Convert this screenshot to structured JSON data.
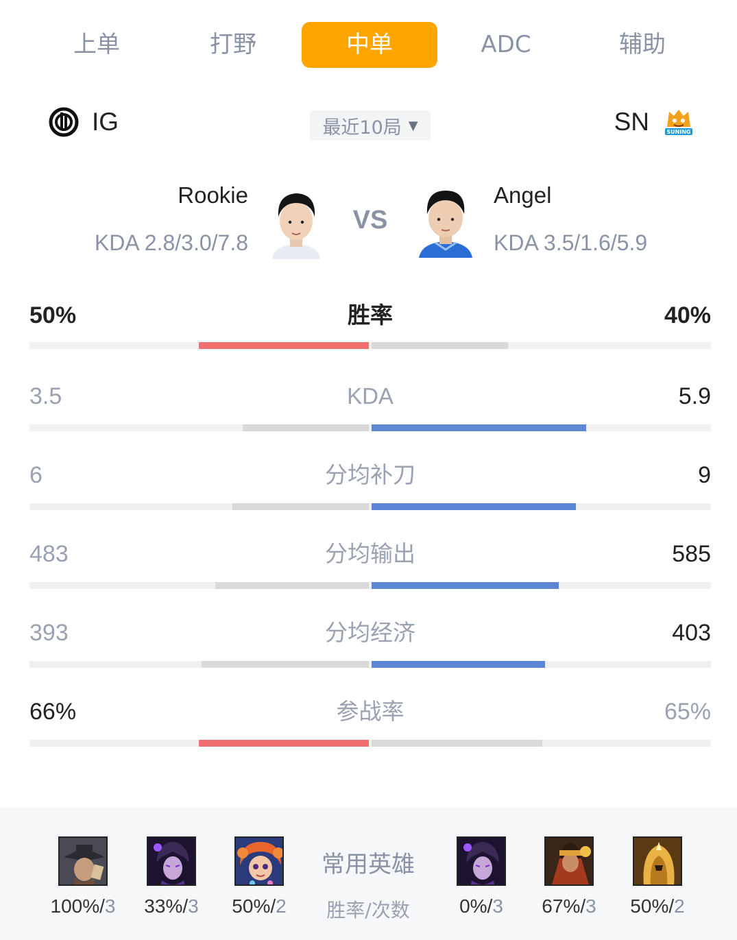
{
  "tabs": [
    {
      "label": "上单",
      "active": false
    },
    {
      "label": "打野",
      "active": false
    },
    {
      "label": "中单",
      "active": true
    },
    {
      "label": "ADC",
      "active": false
    },
    {
      "label": "辅助",
      "active": false
    }
  ],
  "teams": {
    "left": {
      "name": "IG",
      "logo_icon": "ig-logo-icon"
    },
    "right": {
      "name": "SN",
      "logo_icon": "suning-logo-icon",
      "logo_text": "SUNING"
    }
  },
  "filter": {
    "label": "最近10局",
    "icon": "caret-down-icon"
  },
  "players": {
    "left": {
      "name": "Rookie",
      "kda": "KDA 2.8/3.0/7.8"
    },
    "right": {
      "name": "Angel",
      "kda": "KDA 3.5/1.6/5.9"
    },
    "vs": "VS"
  },
  "colors": {
    "accent": "#ffa500",
    "win_red": "#f07070",
    "blue": "#5b87d6",
    "neutral_bar": "#d9d9db",
    "track": "#f0f0f0"
  },
  "stats": [
    {
      "label": "胜率",
      "left": "50%",
      "right": "40%",
      "left_fraction": 0.5,
      "right_fraction": 0.4,
      "winner": "left",
      "left_color": "win_red"
    },
    {
      "label": "KDA",
      "left": "3.5",
      "right": "5.9",
      "left_fraction": 0.37,
      "right_fraction": 0.63,
      "winner": "right",
      "right_color": "blue"
    },
    {
      "label": "分均补刀",
      "left": "6",
      "right": "9",
      "left_fraction": 0.4,
      "right_fraction": 0.6,
      "winner": "right",
      "right_color": "blue"
    },
    {
      "label": "分均输出",
      "left": "483",
      "right": "585",
      "left_fraction": 0.45,
      "right_fraction": 0.55,
      "winner": "right",
      "right_color": "blue"
    },
    {
      "label": "分均经济",
      "left": "393",
      "right": "403",
      "left_fraction": 0.49,
      "right_fraction": 0.51,
      "winner": "right",
      "right_color": "blue"
    },
    {
      "label": "参战率",
      "left": "66%",
      "right": "65%",
      "left_fraction": 0.5,
      "right_fraction": 0.5,
      "winner": "left",
      "left_color": "win_red"
    }
  ],
  "heroes": {
    "title": "常用英雄",
    "subtitle": "胜率/次数",
    "left": [
      {
        "icon": "twisted-fate-hero-icon",
        "rate": "100%",
        "count": "3"
      },
      {
        "icon": "syndra-hero-icon",
        "rate": "33%",
        "count": "3"
      },
      {
        "icon": "zoe-hero-icon",
        "rate": "50%",
        "count": "2"
      }
    ],
    "right": [
      {
        "icon": "syndra-hero-icon",
        "rate": "0%",
        "count": "3"
      },
      {
        "icon": "jayce-hero-icon",
        "rate": "67%",
        "count": "3"
      },
      {
        "icon": "azir-hero-icon",
        "rate": "50%",
        "count": "2"
      }
    ]
  }
}
